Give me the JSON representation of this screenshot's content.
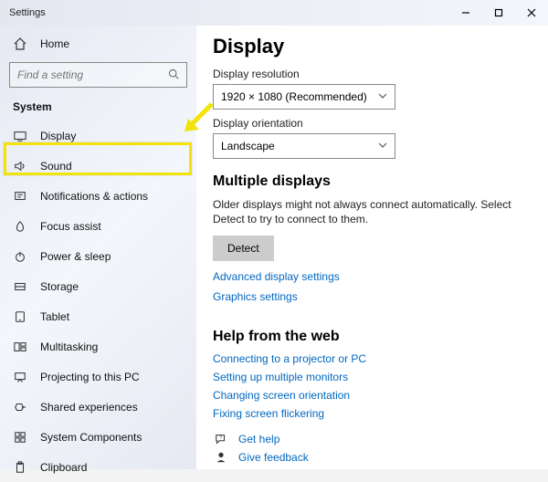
{
  "window": {
    "title": "Settings"
  },
  "sidebar": {
    "home_label": "Home",
    "search_placeholder": "Find a setting",
    "group_label": "System",
    "items": [
      {
        "label": "Display"
      },
      {
        "label": "Sound"
      },
      {
        "label": "Notifications & actions"
      },
      {
        "label": "Focus assist"
      },
      {
        "label": "Power & sleep"
      },
      {
        "label": "Storage"
      },
      {
        "label": "Tablet"
      },
      {
        "label": "Multitasking"
      },
      {
        "label": "Projecting to this PC"
      },
      {
        "label": "Shared experiences"
      },
      {
        "label": "System Components"
      },
      {
        "label": "Clipboard"
      }
    ]
  },
  "main": {
    "heading": "Display",
    "resolution_label": "Display resolution",
    "resolution_value": "1920 × 1080 (Recommended)",
    "orientation_label": "Display orientation",
    "orientation_value": "Landscape",
    "multiple_heading": "Multiple displays",
    "multiple_para": "Older displays might not always connect automatically. Select Detect to try to connect to them.",
    "detect_label": "Detect",
    "adv_link": "Advanced display settings",
    "gfx_link": "Graphics settings",
    "help_heading": "Help from the web",
    "help_links": [
      "Connecting to a projector or PC",
      "Setting up multiple monitors",
      "Changing screen orientation",
      "Fixing screen flickering"
    ],
    "get_help_label": "Get help",
    "feedback_label": "Give feedback"
  }
}
